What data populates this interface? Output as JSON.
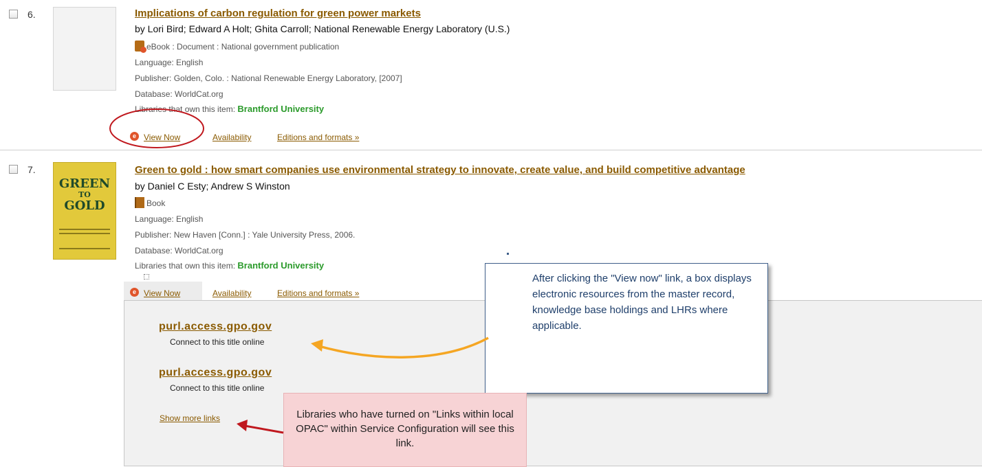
{
  "results": [
    {
      "number": "6.",
      "title": "Implications of carbon regulation for green power markets",
      "byline": "by Lori Bird; Edward A Holt; Ghita Carroll; National Renewable Energy Laboratory (U.S.)",
      "format": "eBook : Document : National government publication",
      "format_icon": "ebook-icon",
      "language": "Language: English",
      "publisher": "Publisher: Golden, Colo. : National Renewable Energy Laboratory, [2007]",
      "database": "Database: WorldCat.org",
      "libraries_label": "Libraries that own this item: ",
      "library": "Brantford University",
      "actions": {
        "view_now": "View Now",
        "availability": "Availability",
        "editions": "Editions and formats »"
      }
    },
    {
      "number": "7.",
      "title": "Green to gold : how smart companies use environmental strategy to innovate, create value, and build competitive advantage",
      "byline": "by Daniel C Esty; Andrew S Winston",
      "format": "Book",
      "format_icon": "book-icon",
      "language": "Language: English",
      "publisher": "Publisher: New Haven [Conn.] : Yale University Press, 2006.",
      "database": "Database: WorldCat.org",
      "libraries_label": "Libraries that own this item: ",
      "library": "Brantford University",
      "cover": {
        "line1": "GREEN",
        "line2": "TO",
        "line3": "GOLD"
      },
      "actions": {
        "view_now": "View Now",
        "availability": "Availability",
        "editions": "Editions and formats »"
      }
    }
  ],
  "view_now_panel": {
    "links": [
      {
        "url": "purl.access.gpo.gov",
        "caption": "Connect to this title online"
      },
      {
        "url": "purl.access.gpo.gov",
        "caption": "Connect to this title online"
      }
    ],
    "show_more": "Show more links"
  },
  "annotations": {
    "callout_view_now": "After clicking the \"View now\" link, a box displays electronic resources from the master record, knowledge base holdings and LHRs where applicable.",
    "callout_show_more": "Libraries who have turned on \"Links within local OPAC\" within Service Configuration will see this link."
  },
  "colors": {
    "link": "#8a5a00",
    "library": "#2a9a2a",
    "callout_border": "#3f5f8a",
    "callout_pink": "#f7d3d5",
    "arrow_orange": "#f5a623",
    "arrow_red": "#c0181e",
    "circle_red": "#c0181e"
  }
}
